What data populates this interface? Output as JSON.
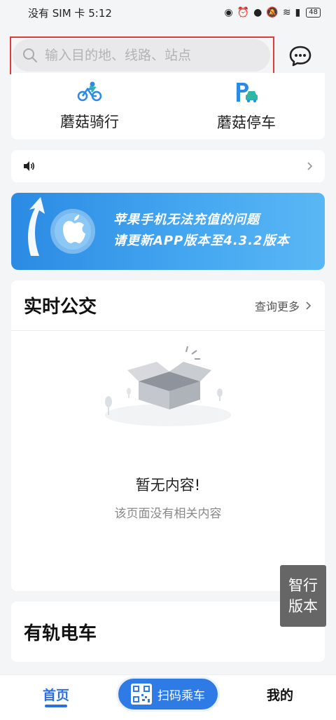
{
  "status_bar": {
    "carrier": "没有 SIM 卡",
    "time": "5:12",
    "battery": "48"
  },
  "search": {
    "placeholder": "输入目的地、线路、站点"
  },
  "services": [
    {
      "label": "蘑菇骑行",
      "icon": "bicycle-icon",
      "color": "#2b8ae3"
    },
    {
      "label": "蘑菇停车",
      "icon": "parking-icon",
      "color": "#2b8ae3"
    }
  ],
  "notice": {
    "icon": "speaker-icon"
  },
  "banner": {
    "line1": "苹果手机无法充值的问题",
    "line2": "请更新APP版本至4.3.2版本"
  },
  "realtime_bus": {
    "title": "实时公交",
    "more": "查询更多",
    "empty_title": "暂无内容!",
    "empty_subtitle": "该页面没有相关内容"
  },
  "tram": {
    "title": "有轨电车"
  },
  "float_button": {
    "line1": "智行",
    "line2": "版本"
  },
  "tabbar": {
    "home": "首页",
    "scan": "扫码乘车",
    "me": "我的"
  },
  "colors": {
    "accent": "#2b6fe0",
    "highlight": "#e03b3b"
  }
}
